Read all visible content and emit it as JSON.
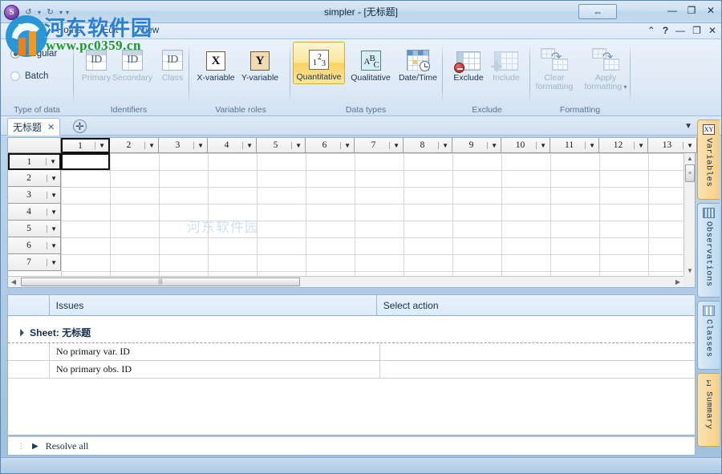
{
  "window": {
    "title": "simpler - [无标题]",
    "app_orb_letter": "S",
    "restore_center_icon": "⇔",
    "minimize_icon": "—",
    "maximize_icon": "❐",
    "close_icon": "✕"
  },
  "quick_access": {
    "items": [
      {
        "name": "undo-icon",
        "glyph": "↺"
      },
      {
        "name": "redo-icon",
        "glyph": "↻"
      },
      {
        "name": "customize-qat-icon",
        "glyph": "▾"
      }
    ]
  },
  "menubar": {
    "tabs": [
      {
        "label": "Home",
        "active": true
      },
      {
        "label": "Edit",
        "active": false
      },
      {
        "label": "View",
        "active": false
      }
    ],
    "right_icons": [
      {
        "name": "ribbon-collapse-icon",
        "glyph": "⌃"
      },
      {
        "name": "help-icon",
        "glyph": "?"
      },
      {
        "name": "mdi-minimize-icon",
        "glyph": "—"
      },
      {
        "name": "mdi-restore-icon",
        "glyph": "❐"
      },
      {
        "name": "mdi-close-icon",
        "glyph": "✕"
      }
    ]
  },
  "ribbon": {
    "groups": [
      {
        "label": "Type of data",
        "options": [
          {
            "label": "Regular",
            "selected": true
          },
          {
            "label": "Batch",
            "selected": false
          }
        ]
      },
      {
        "label": "Identifiers",
        "buttons": [
          {
            "label": "Primary",
            "icon": "id-icon",
            "disabled": true
          },
          {
            "label": "Secondary",
            "icon": "id-icon",
            "disabled": true
          },
          {
            "label": "Class",
            "icon": "id-icon",
            "disabled": true
          }
        ]
      },
      {
        "label": "Variable roles",
        "buttons": [
          {
            "label": "X-variable",
            "icon": "x-variable-icon",
            "disabled": false
          },
          {
            "label": "Y-variable",
            "icon": "y-variable-icon",
            "disabled": false
          }
        ]
      },
      {
        "label": "Data types",
        "buttons": [
          {
            "label": "Quantitative",
            "icon": "numbers-icon",
            "selected": true
          },
          {
            "label": "Qualitative",
            "icon": "abc-icon",
            "selected": false
          },
          {
            "label": "Date/Time",
            "icon": "calendar-clock-icon",
            "selected": false
          }
        ]
      },
      {
        "label": "Exclude",
        "buttons": [
          {
            "label": "Exclude",
            "icon": "exclude-icon",
            "disabled": false
          },
          {
            "label": "Include",
            "icon": "include-icon",
            "disabled": true
          }
        ]
      },
      {
        "label": "Formatting",
        "buttons": [
          {
            "label": "Clear\nformatting",
            "line1": "Clear",
            "line2": "formatting",
            "icon": "clear-formatting-icon",
            "disabled": true
          },
          {
            "label": "Apply formatting",
            "line1": "Apply",
            "line2": "formatting",
            "icon": "apply-formatting-icon",
            "disabled": true,
            "has_dropdown": true
          }
        ]
      }
    ],
    "labels": {
      "type_of_data": "Type of data",
      "identifiers": "Identifiers",
      "variable_roles": "Variable roles",
      "data_types": "Data types",
      "exclude": "Exclude",
      "formatting": "Formatting"
    },
    "btn": {
      "regular": "Regular",
      "batch": "Batch",
      "primary": "Primary",
      "secondary": "Secondary",
      "class": "Class",
      "xvar": "X-variable",
      "yvar": "Y-variable",
      "quantitative": "Quantitative",
      "qualitative": "Qualitative",
      "datetime": "Date/Time",
      "exclude": "Exclude",
      "include": "Include",
      "clear_l1": "Clear",
      "clear_l2": "formatting",
      "apply_l1": "Apply",
      "apply_l2": "formatting"
    }
  },
  "sheet_tabs": {
    "tabs": [
      {
        "label": "无标题",
        "close_glyph": "✕",
        "active": true
      }
    ],
    "add_glyph": "✛",
    "collapse_glyph": "▼"
  },
  "spreadsheet": {
    "columns": [
      "1",
      "2",
      "3",
      "4",
      "5",
      "6",
      "7",
      "8",
      "9",
      "10",
      "11",
      "12",
      "13"
    ],
    "rows": [
      "1",
      "2",
      "3",
      "4",
      "5",
      "6",
      "7"
    ],
    "selected_column": "1",
    "selected_row": "1",
    "active_cell_value": "",
    "dropdown_glyph": "▼",
    "scroll": {
      "h_left_arrow": "◀",
      "h_right_arrow": "▶",
      "v_up_arrow": "▲",
      "v_down_arrow": "▼",
      "h_grip": "|||",
      "v_grip": "≡"
    }
  },
  "issues": {
    "columns": [
      "Issues",
      "Select action"
    ],
    "group": {
      "label": "Sheet: 无标题",
      "expanded": true,
      "tri": "◢"
    },
    "rows": [
      {
        "issue": "No primary var. ID",
        "action": ""
      },
      {
        "issue": "No primary obs. ID",
        "action": ""
      }
    ],
    "resolve_all": {
      "label": "Resolve all",
      "tri": "▶",
      "dots": "⋮"
    }
  },
  "side_tabs": [
    {
      "label": "Variables",
      "icon": "xy-icon",
      "active": true,
      "color": "orange"
    },
    {
      "label": "Observations",
      "icon": "bars-icon",
      "active": false,
      "color": "blue"
    },
    {
      "label": "Classes",
      "icon": "classes-icon",
      "active": false,
      "color": "blue"
    },
    {
      "label": "Summary",
      "icon": "sigma-icon",
      "active": false,
      "color": "orange"
    }
  ],
  "watermark": {
    "text_cn": "河东软件园",
    "text_url": "www.pc0359.cn",
    "faint": "河东软件园"
  },
  "colors": {
    "accent_orange": "#f9d261",
    "titlebar_blue": "#bcd5ea",
    "ribbon_bg": "#e3edf7",
    "panel_border": "#9ab3c9"
  }
}
